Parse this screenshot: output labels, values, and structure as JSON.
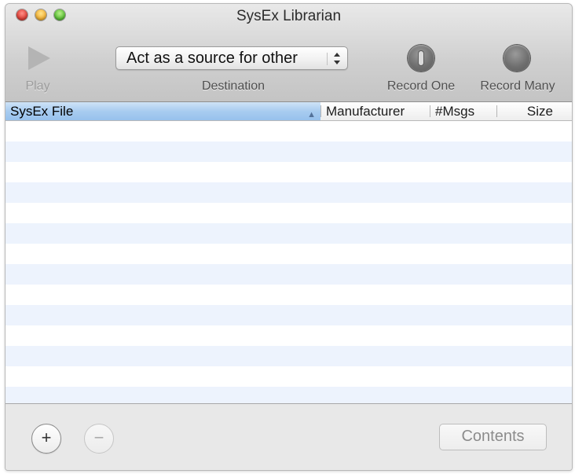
{
  "window": {
    "title": "SysEx Librarian"
  },
  "toolbar": {
    "play_label": "Play",
    "destination_label": "Destination",
    "destination_value": "Act as a source for other",
    "record_one_label": "Record One",
    "record_many_label": "Record Many"
  },
  "table": {
    "columns": [
      {
        "label": "SysEx File",
        "sorted": true,
        "sort_direction": "ascending"
      },
      {
        "label": "Manufacturer"
      },
      {
        "label": "#Msgs"
      },
      {
        "label": "Size"
      }
    ],
    "rows": []
  },
  "bottom": {
    "add_symbol": "+",
    "remove_symbol": "−",
    "contents_label": "Contents"
  },
  "colors": {
    "sorted_header": "#a8ccf0",
    "alt_row": "#edf3fd",
    "close": "#e0443b",
    "minimize": "#f5b53a",
    "zoom": "#5fc33a"
  },
  "icons": {
    "play": "play-triangle-icon",
    "record_one": "record-one-icon",
    "record_many": "record-many-icon",
    "sort": "sort-up-icon"
  }
}
